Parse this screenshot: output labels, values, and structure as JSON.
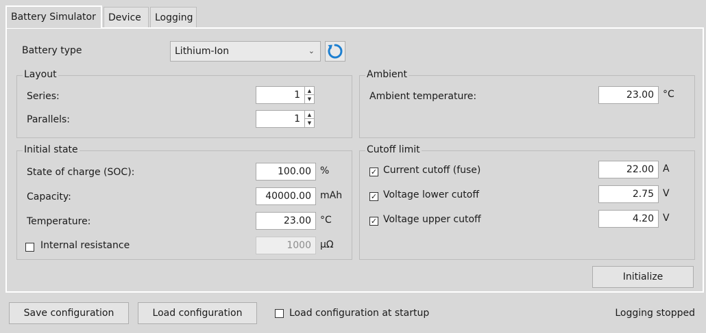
{
  "tabs": [
    "Battery Simulator",
    "Device",
    "Logging"
  ],
  "battery_type": {
    "label": "Battery type",
    "value": "Lithium-Ion"
  },
  "layout": {
    "title": "Layout",
    "series_label": "Series:",
    "series_value": "1",
    "parallels_label": "Parallels:",
    "parallels_value": "1"
  },
  "ambient": {
    "title": "Ambient",
    "temp_label": "Ambient temperature:",
    "temp_value": "23.00",
    "temp_unit": "°C"
  },
  "initial_state": {
    "title": "Initial state",
    "soc_label": "State of charge (SOC):",
    "soc_value": "100.00",
    "soc_unit": "%",
    "capacity_label": "Capacity:",
    "capacity_value": "40000.00",
    "capacity_unit": "mAh",
    "temperature_label": "Temperature:",
    "temperature_value": "23.00",
    "temperature_unit": "°C",
    "resistance_label": "Internal resistance",
    "resistance_value": "1000",
    "resistance_unit": "μΩ",
    "resistance_checked": false
  },
  "cutoff": {
    "title": "Cutoff limit",
    "current_label": "Current cutoff (fuse)",
    "current_value": "22.00",
    "current_unit": "A",
    "current_checked": true,
    "vlow_label": "Voltage lower cutoff",
    "vlow_value": "2.75",
    "vlow_unit": "V",
    "vlow_checked": true,
    "vhigh_label": "Voltage upper cutoff",
    "vhigh_value": "4.20",
    "vhigh_unit": "V",
    "vhigh_checked": true
  },
  "buttons": {
    "initialize": "Initialize",
    "save": "Save configuration",
    "load": "Load configuration"
  },
  "startup": {
    "label": "Load configuration at startup",
    "checked": false
  },
  "status": "Logging stopped",
  "colors": {
    "refresh_icon": "#1d7fd0"
  }
}
